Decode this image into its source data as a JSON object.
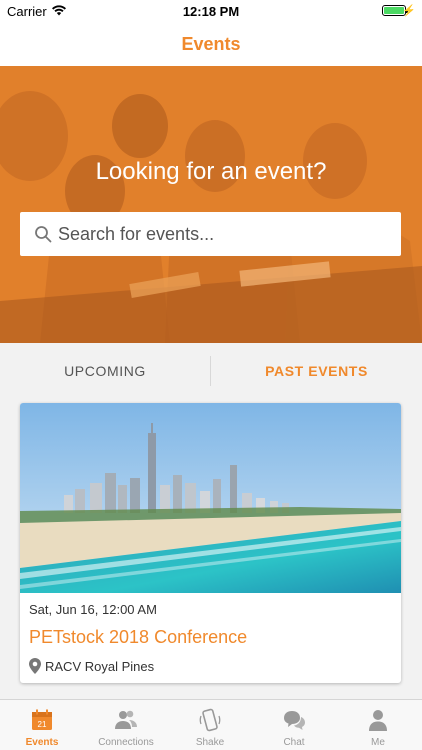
{
  "status_bar": {
    "carrier": "Carrier",
    "time": "12:18 PM",
    "battery_color": "#4cd964"
  },
  "nav": {
    "title": "Events"
  },
  "hero": {
    "headline": "Looking for an event?",
    "search_placeholder": "Search for events...",
    "search_icon": "search-icon"
  },
  "tabs": [
    {
      "label": "UPCOMING",
      "active": false
    },
    {
      "label": "PAST EVENTS",
      "active": true
    }
  ],
  "events": [
    {
      "date": "Sat, Jun 16, 12:00 AM",
      "title": "PETstock 2018 Conference",
      "location": "RACV Royal Pines",
      "location_icon": "pin-icon"
    }
  ],
  "tab_bar": [
    {
      "label": "Events",
      "icon": "calendar-icon",
      "badge_text": "21",
      "active": true
    },
    {
      "label": "Connections",
      "icon": "people-icon",
      "active": false
    },
    {
      "label": "Shake",
      "icon": "phone-shake-icon",
      "active": false
    },
    {
      "label": "Chat",
      "icon": "chat-bubbles-icon",
      "active": false
    },
    {
      "label": "Me",
      "icon": "person-icon",
      "active": false
    }
  ],
  "colors": {
    "accent": "#f0892c",
    "inactive": "#999999"
  }
}
